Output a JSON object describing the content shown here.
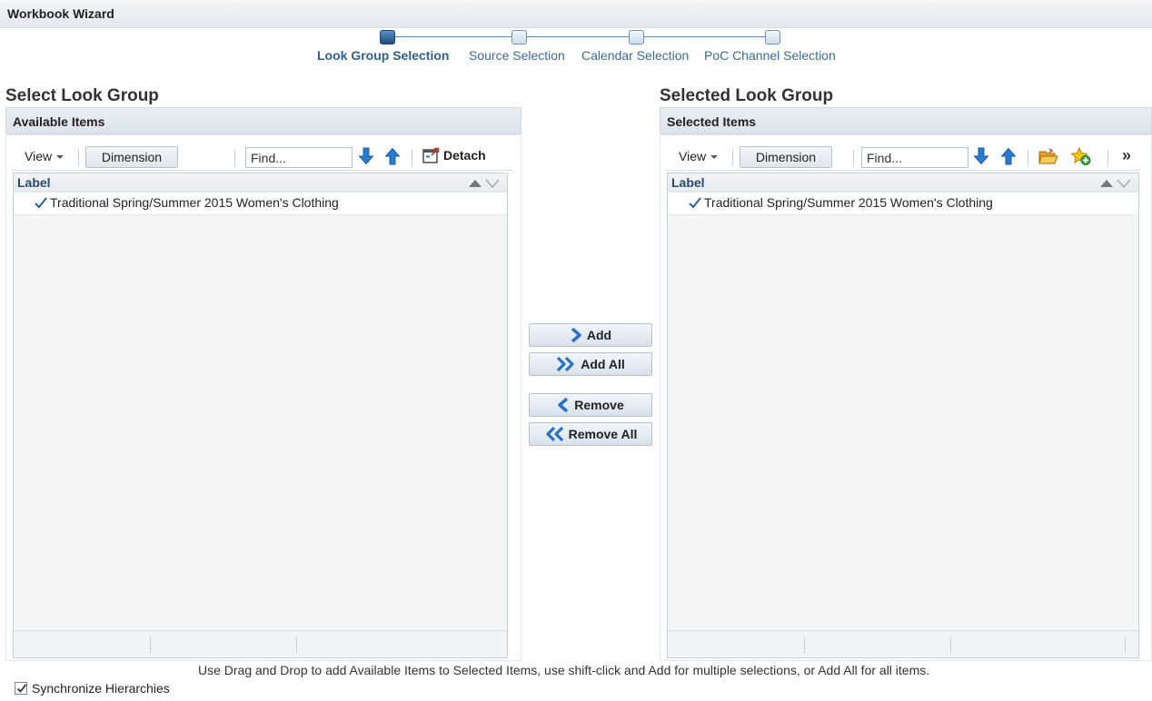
{
  "window": {
    "title": "Workbook Wizard"
  },
  "train": {
    "steps": [
      {
        "label": "Look Group Selection",
        "state": "current"
      },
      {
        "label": "Source Selection",
        "state": "pending"
      },
      {
        "label": "Calendar Selection",
        "state": "pending"
      },
      {
        "label": "PoC Channel Selection",
        "state": "pending"
      }
    ]
  },
  "left": {
    "heading": "Select Look Group",
    "panel_title": "Available Items",
    "toolbar": {
      "view_label": "View",
      "dimension_label": "Dimension",
      "find_placeholder": "Find...",
      "detach_label": "Detach"
    },
    "grid": {
      "column_label": "Label",
      "rows": [
        {
          "text": "Traditional Spring/Summer 2015 Women's Clothing",
          "checked": true
        }
      ]
    }
  },
  "right": {
    "heading": "Selected Look Group",
    "panel_title": "Selected Items",
    "toolbar": {
      "view_label": "View",
      "dimension_label": "Dimension",
      "find_placeholder": "Find...",
      "overflow_label": "»"
    },
    "grid": {
      "column_label": "Label",
      "rows": [
        {
          "text": "Traditional Spring/Summer 2015 Women's Clothing",
          "checked": true
        }
      ]
    }
  },
  "shuttle": {
    "add_label": "Add",
    "add_all_label": "Add All",
    "remove_label": "Remove",
    "remove_all_label": "Remove All"
  },
  "instructions": "Use Drag and Drop to add Available Items to Selected Items, use shift-click and Add for multiple selections, or Add All for all items.",
  "sync": {
    "label": "Synchronize Hierarchies",
    "checked": true
  },
  "icons": {
    "find_next": "arrow-down-icon",
    "find_prev": "arrow-up-icon",
    "detach": "detach-icon",
    "open_folder": "open-folder-icon",
    "add_favorite": "star-add-icon",
    "checkmark": "checkmark-icon"
  },
  "colors": {
    "accent": "#2f5f8a",
    "arrow_blue": "#2b7bd0",
    "train_current": "#1f4f80"
  }
}
